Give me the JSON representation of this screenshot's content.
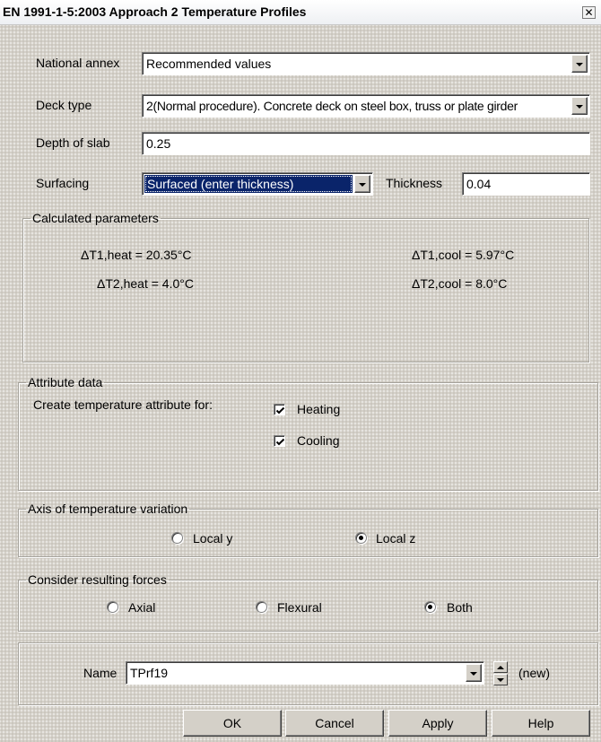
{
  "window": {
    "title": "EN 1991-1-5:2003 Approach 2 Temperature Profiles",
    "close_glyph": "✕"
  },
  "national_annex": {
    "label": "National annex",
    "value": "Recommended values"
  },
  "deck_type": {
    "label": "Deck type",
    "value": "2(Normal procedure). Concrete deck on steel box, truss or plate girder"
  },
  "depth_of_slab": {
    "label": "Depth of slab",
    "value": "0.25"
  },
  "surfacing": {
    "label": "Surfacing",
    "value": "Surfaced (enter thickness)",
    "thickness_label": "Thickness",
    "thickness_value": "0.04"
  },
  "calculated_parameters": {
    "legend": "Calculated parameters",
    "dt1_heat": "ΔT1,heat = 20.35°C",
    "dt1_cool": "ΔT1,cool = 5.97°C",
    "dt2_heat": "ΔT2,heat = 4.0°C",
    "dt2_cool": "ΔT2,cool = 8.0°C"
  },
  "attribute_data": {
    "legend": "Attribute data",
    "create_label": "Create temperature attribute for:",
    "heating_label": "Heating",
    "heating_checked": true,
    "cooling_label": "Cooling",
    "cooling_checked": true
  },
  "axis_variation": {
    "legend": "Axis of temperature variation",
    "local_y_label": "Local y",
    "local_z_label": "Local z",
    "selected": "Local z"
  },
  "resulting_forces": {
    "legend": "Consider resulting forces",
    "axial_label": "Axial",
    "flexural_label": "Flexural",
    "both_label": "Both",
    "selected": "Both"
  },
  "name_row": {
    "label": "Name",
    "value": "TPrf19",
    "new_label": "(new)"
  },
  "buttons": {
    "ok": "OK",
    "cancel": "Cancel",
    "apply": "Apply",
    "help": "Help"
  },
  "icons": {
    "checkmark": "checkmark-icon",
    "dropdown": "chevron-down-icon",
    "spin_up": "spin-up-icon",
    "spin_down": "spin-down-icon"
  },
  "colors": {
    "dialog_bg": "#d4d0c8",
    "selection": "#0a246a",
    "field_bg": "#ffffff"
  }
}
